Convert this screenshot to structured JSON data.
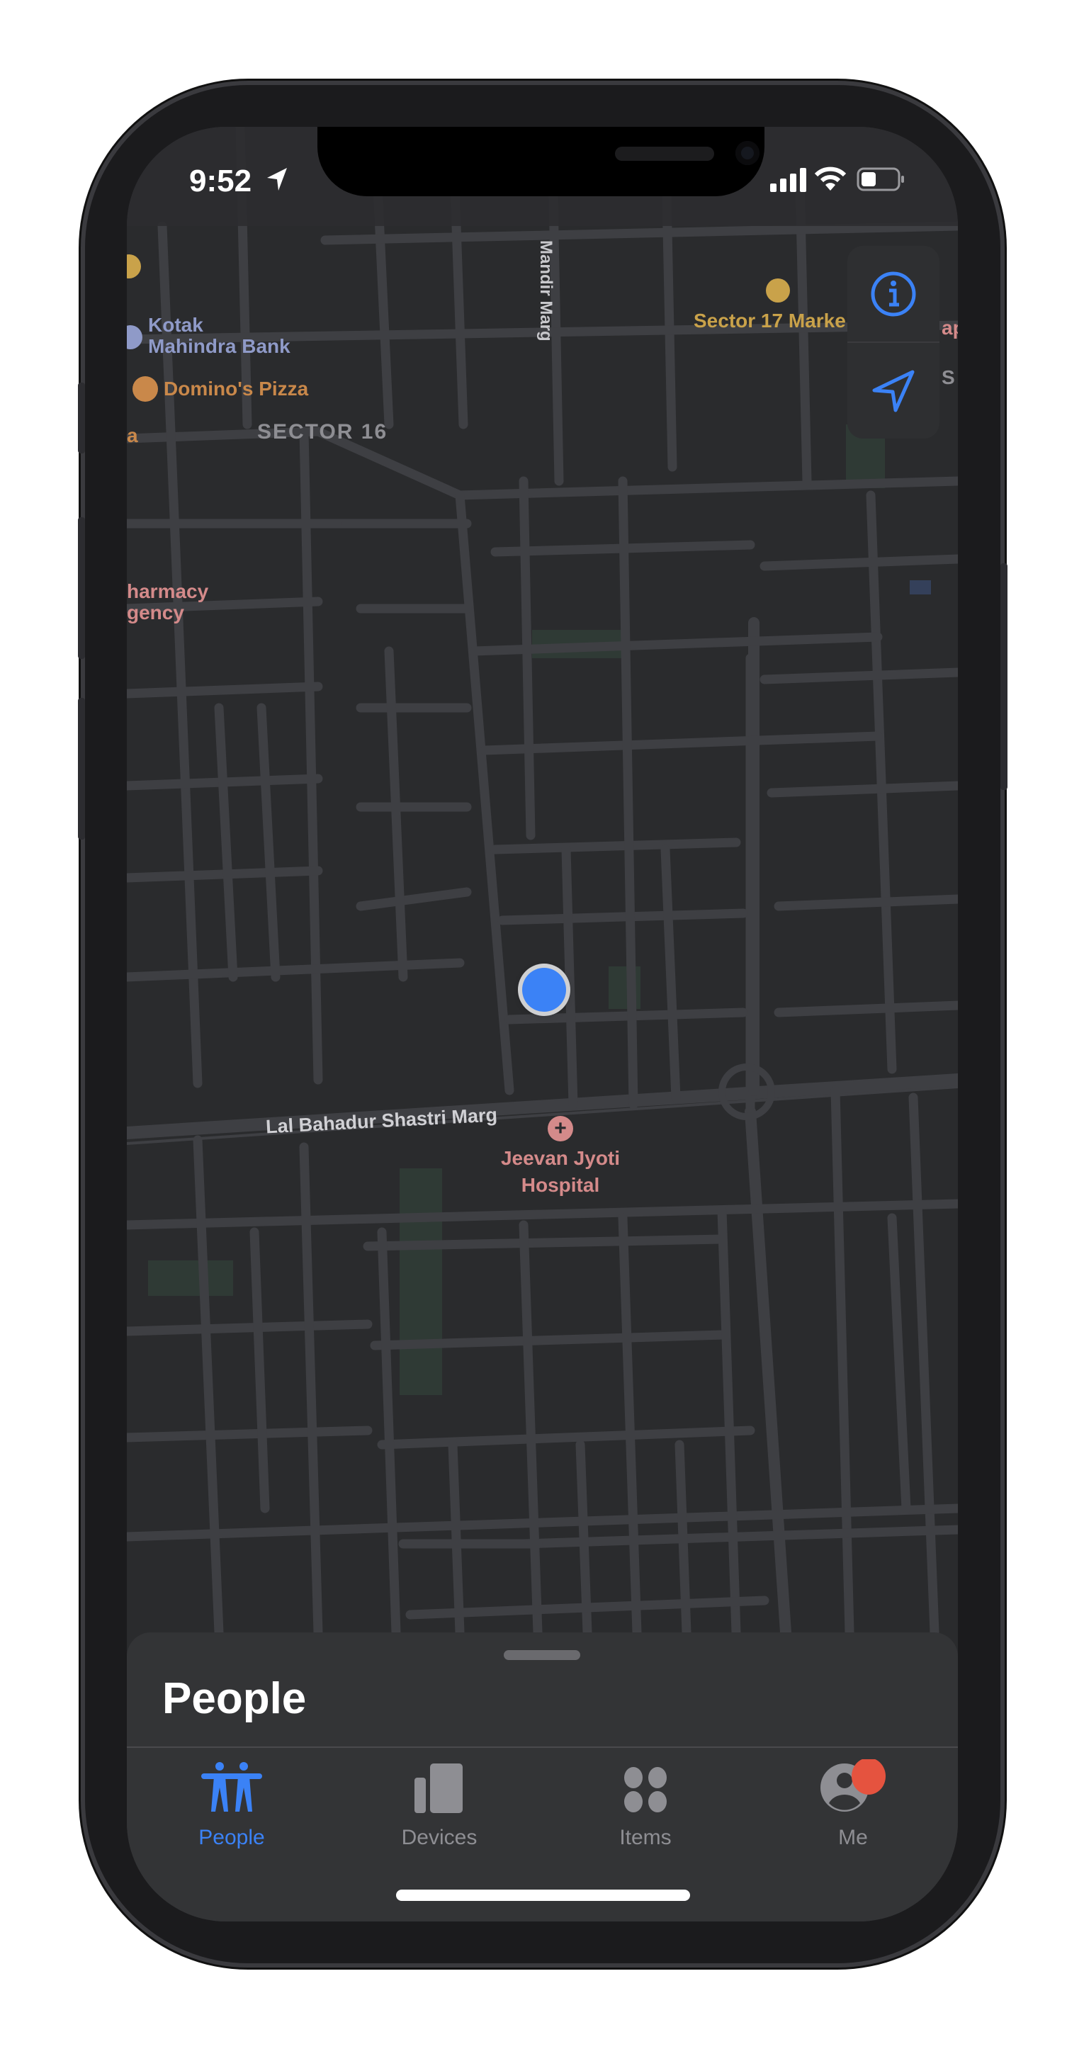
{
  "status_bar": {
    "time": "9:52",
    "location_icon": "location-arrow-icon",
    "signal_icon": "cellular-signal-icon",
    "wifi_icon": "wifi-icon",
    "battery_icon": "battery-icon"
  },
  "map": {
    "labels": {
      "mandir_marg": "Mandir Marg",
      "sector17": "Sector 17 Marke",
      "kotak1": "Kotak",
      "kotak2": "Mahindra Bank",
      "dominos": "Domino's Pizza",
      "sector16": "SECTOR 16",
      "pharmacy1": "harmacy",
      "pharmacy2": "gency",
      "lbs_marg": "Lal Bahadur Shastri Marg",
      "hospital1": "Jeevan Jyoti",
      "hospital2": "Hospital",
      "edge_a": "a",
      "edge_p": "ap",
      "edge_s": "S"
    },
    "colors": {
      "background": "#2a2b2d",
      "road": "#3e3f43",
      "park": "#2f3a35",
      "food": "#c9884a",
      "shopping": "#c9a24a",
      "bank": "#8f9ac8",
      "health": "#d48a8a",
      "user_location": "#3b82f6"
    }
  },
  "controls": {
    "info_icon": "info-icon",
    "locate_icon": "location-arrow-icon",
    "accent": "#3b82f6"
  },
  "sheet": {
    "title": "People"
  },
  "tabs": [
    {
      "label": "People",
      "icon": "people-icon",
      "active": true
    },
    {
      "label": "Devices",
      "icon": "devices-icon",
      "active": false
    },
    {
      "label": "Items",
      "icon": "items-icon",
      "active": false
    },
    {
      "label": "Me",
      "icon": "me-icon",
      "active": false,
      "badge": true
    }
  ],
  "badge_color": "#e5533f"
}
